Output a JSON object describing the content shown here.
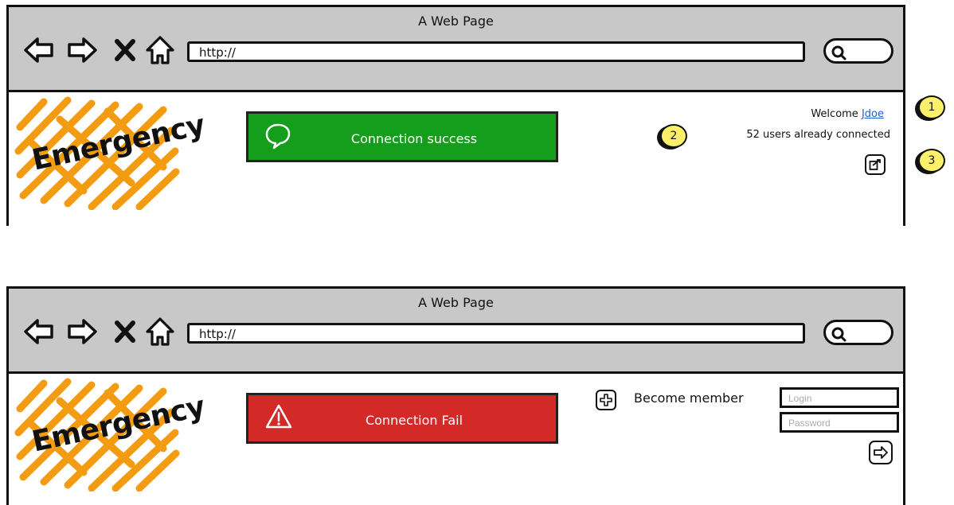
{
  "top_window": {
    "title": "A Web Page",
    "url_value": "http://",
    "logo_text": "Emergency",
    "banner": {
      "label": "Connection success",
      "color": "#159e1c",
      "icon": "speech-bubble-icon"
    },
    "welcome_prefix": "Welcome",
    "username": "Jdoe",
    "users_connected": "52 users already connected",
    "logout_icon": "logout-icon"
  },
  "callouts": [
    "1",
    "2",
    "3"
  ],
  "bottom_window": {
    "title": "A Web Page",
    "url_value": "http://",
    "logo_text": "Emergency",
    "banner": {
      "label": "Connection Fail",
      "color": "#d32a28",
      "icon": "warning-icon"
    },
    "become_member_label": "Become member",
    "login_placeholder": "Login",
    "password_placeholder": "Password",
    "submit_icon": "arrow-right-icon"
  },
  "colors": {
    "chrome": "#c8c8c8",
    "logo_scribble": "#f39c12",
    "callout": "#fff06a",
    "link": "#1c5ed0"
  }
}
